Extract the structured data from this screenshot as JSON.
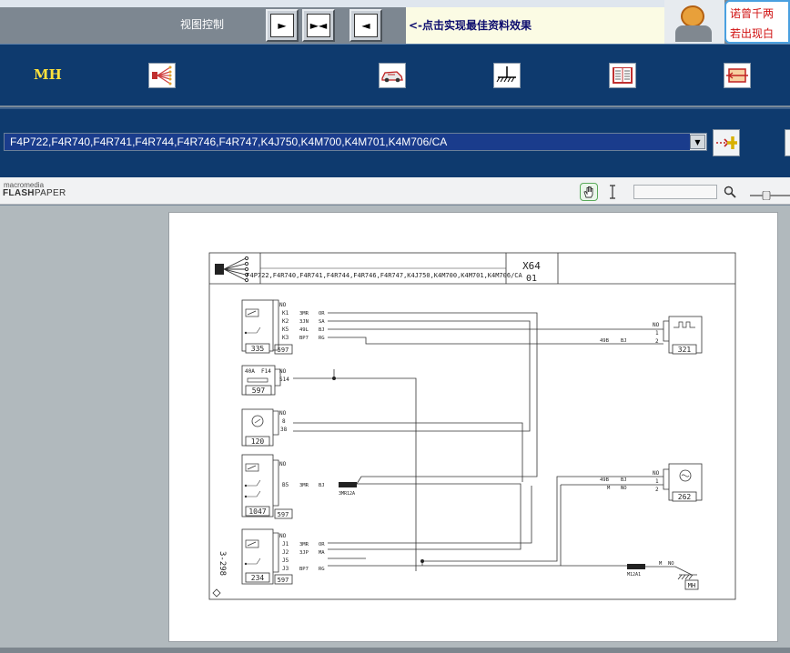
{
  "viewer": {
    "view_control_label": "视图控制",
    "view_buttons": [
      "►",
      "►◄",
      "◄"
    ],
    "hint_text": "<-点击实现最佳资料效果",
    "promo_lines": [
      "诺曾千两",
      "若出现白"
    ]
  },
  "navbar": {
    "brand": "MH",
    "icons": [
      "wiring-harness-icon",
      "vehicle-icon",
      "ground-symbol-icon",
      "manual-book-icon",
      "connector-icon"
    ]
  },
  "engine_select": {
    "value": "F4P722,F4R740,F4R741,F4R744,F4R746,F4R747,K4J750,K4M700,K4M701,K4M706/CA",
    "go_icon": "add-arrow-icon"
  },
  "flashpaper": {
    "logo_top": "macromedia",
    "logo_bold": "FLASH",
    "logo_rest": "PAPER",
    "tools": [
      "hand-tool-icon",
      "text-select-icon",
      "search-icon",
      "zoom-slider"
    ]
  },
  "diagram": {
    "header_code": "F4P722,F4R740,F4R741,F4R744,F4R746,F4R747,K4J750,K4M700,K4M701,K4M706/CA",
    "connector_id": "X64",
    "sheet": "01",
    "page_ref": "3-298",
    "components": [
      {
        "id": "335",
        "ref": "597",
        "pins": [
          "NO",
          "K1",
          "K2",
          "K5",
          "K3"
        ],
        "wires": [
          "3MR",
          "3JN",
          "49L",
          "BP7"
        ],
        "colors": [
          "OR",
          "SA",
          "BJ",
          "RG"
        ]
      },
      {
        "id": "597",
        "fuse": "40A",
        "fuse_id": "F14",
        "pins": [
          "NO",
          "S14"
        ]
      },
      {
        "id": "120",
        "pins": [
          "NO",
          "8",
          "38"
        ]
      },
      {
        "id": "1047",
        "ref": "597",
        "pins": [
          "NO",
          "B5"
        ],
        "wires": [
          "3MR"
        ],
        "colors": [
          "BJ"
        ],
        "splice": "3MR12A"
      },
      {
        "id": "234",
        "ref": "597",
        "pins": [
          "NO",
          "J1",
          "J2",
          "J5",
          "J3"
        ],
        "wires": [
          "3MR",
          "3JP",
          "BP7"
        ],
        "colors": [
          "OR",
          "MA",
          "RG"
        ]
      },
      {
        "id": "321",
        "pins": [
          "NO",
          "1",
          "2"
        ],
        "wires": [
          "49B"
        ],
        "colors": [
          "BJ"
        ]
      },
      {
        "id": "262",
        "pins": [
          "NO",
          "1",
          "2"
        ],
        "wires": [
          "49B",
          "M"
        ],
        "colors": [
          "BJ",
          "NO"
        ]
      },
      {
        "id": "MH",
        "ground": "M",
        "color": "NO",
        "splice": "M12A1"
      }
    ]
  }
}
